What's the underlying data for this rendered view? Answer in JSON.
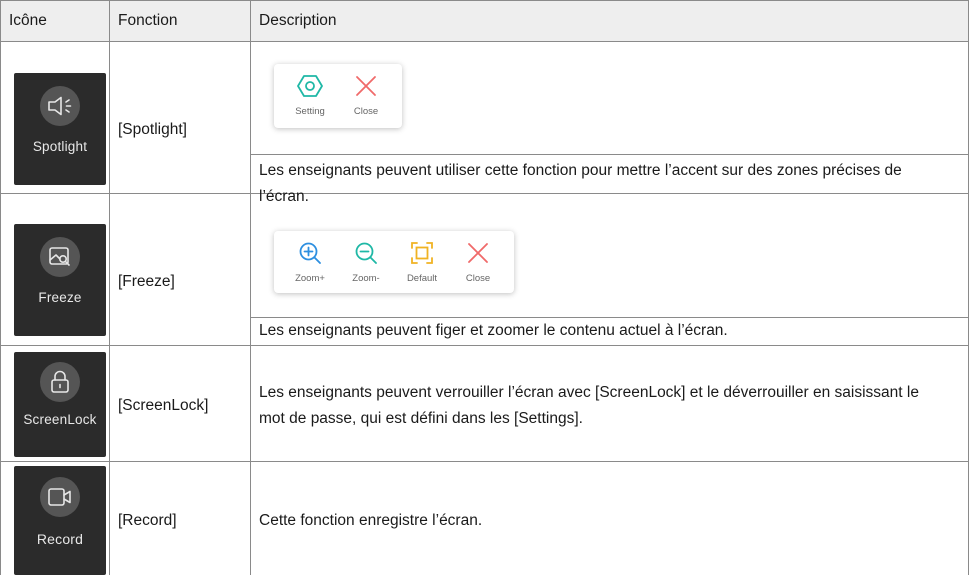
{
  "table": {
    "headers": {
      "icon": "Icône",
      "function": "Fonction",
      "description": "Description"
    },
    "rows": [
      {
        "icon_label": "Spotlight",
        "icon": "spotlight-icon",
        "function": "[Spotlight]",
        "toolbar": [
          {
            "label": "Setting",
            "icon": "hexagon-setting-icon",
            "color": "#1fb8a6"
          },
          {
            "label": "Close",
            "icon": "close-x-icon",
            "color": "#f06a6a"
          }
        ],
        "description": "Les enseignants peuvent utiliser cette fonction pour mettre l’accent sur des zones précises de l’écran."
      },
      {
        "icon_label": "Freeze",
        "icon": "freeze-icon",
        "function": "[Freeze]",
        "toolbar": [
          {
            "label": "Zoom+",
            "icon": "zoom-in-icon",
            "color": "#2d8fe0"
          },
          {
            "label": "Zoom-",
            "icon": "zoom-out-icon",
            "color": "#1fb8a6"
          },
          {
            "label": "Default",
            "icon": "default-frame-icon",
            "color": "#f0b323"
          },
          {
            "label": "Close",
            "icon": "close-x-icon",
            "color": "#f06a6a"
          }
        ],
        "description": "Les enseignants peuvent figer et zoomer le contenu actuel à l’écran."
      },
      {
        "icon_label": "ScreenLock",
        "icon": "lock-icon",
        "function": "[ScreenLock]",
        "description": "Les enseignants peuvent verrouiller l’écran avec [ScreenLock] et le déverrouiller en saisissant le mot de passe, qui est défini dans les [Settings]."
      },
      {
        "icon_label": "Record",
        "icon": "video-record-icon",
        "function": "[Record]",
        "description": "Cette fonction enregistre l’écran."
      }
    ]
  },
  "colors": {
    "header_bg": "#eeeeee",
    "border": "#8a8a8a",
    "tile_bg": "#2b2b2b"
  }
}
